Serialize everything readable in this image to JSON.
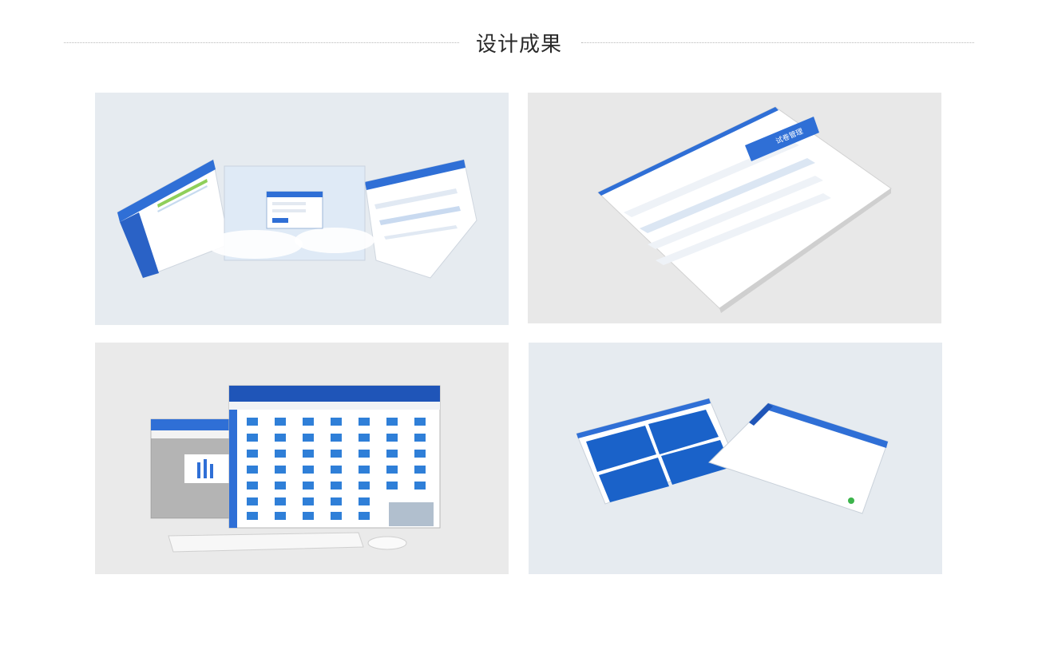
{
  "header": {
    "title": "设计成果"
  },
  "showcase": {
    "panel_colors": {
      "blue": "#2f6fd6",
      "dark_blue": "#1f4fb0",
      "light_bg": "#e6ebf0",
      "green": "#3cb44b"
    },
    "panel2_tag": "试卷管理"
  }
}
